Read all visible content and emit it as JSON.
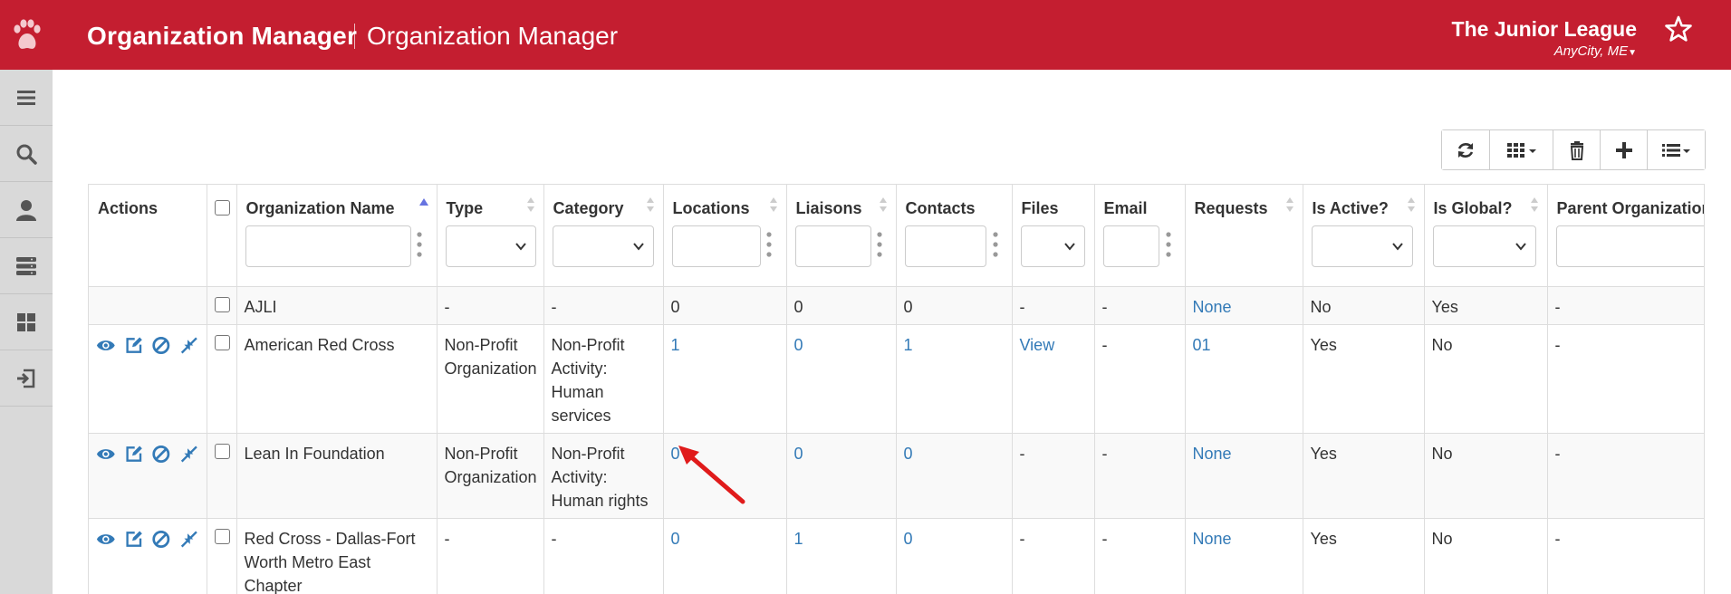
{
  "header": {
    "app_title": "Organization Manager",
    "page_title": "Organization Manager",
    "org_name": "The Junior League",
    "org_city": "AnyCity, ME",
    "brand_color": "#c41e30"
  },
  "sidebar": {
    "items": [
      {
        "icon": "menu-icon"
      },
      {
        "icon": "search-icon"
      },
      {
        "icon": "user-icon"
      },
      {
        "icon": "server-icon"
      },
      {
        "icon": "dashboard-icon"
      },
      {
        "icon": "sign-out-icon"
      }
    ]
  },
  "toolbar": {
    "buttons": [
      "refresh-icon",
      "columns-icon",
      "trash-icon",
      "plus-icon",
      "list-icon"
    ]
  },
  "table": {
    "columns": {
      "actions": "Actions",
      "name": "Organization Name",
      "type": "Type",
      "category": "Category",
      "locations": "Locations",
      "liaisons": "Liaisons",
      "contacts": "Contacts",
      "files": "Files",
      "email": "Email",
      "requests": "Requests",
      "active": "Is Active?",
      "global": "Is Global?",
      "parent": "Parent Organization"
    },
    "rows": [
      {
        "name": "AJLI",
        "type": "-",
        "category": "-",
        "locations": "0",
        "liaisons": "0",
        "contacts": "0",
        "files": "-",
        "email": "-",
        "requests": "None",
        "active": "No",
        "global": "Yes",
        "parent": "-"
      },
      {
        "name": "American Red Cross",
        "type": "Non-Profit Organization",
        "category": "Non-Profit Activity: Human services",
        "locations": "1",
        "liaisons": "0",
        "contacts": "1",
        "files": "View",
        "email": "-",
        "requests": "01",
        "active": "Yes",
        "global": "No",
        "parent": "-"
      },
      {
        "name": "Lean In Foundation",
        "type": "Non-Profit Organization",
        "category": "Non-Profit Activity: Human rights",
        "locations": "0",
        "liaisons": "0",
        "contacts": "0",
        "files": "-",
        "email": "-",
        "requests": "None",
        "active": "Yes",
        "global": "No",
        "parent": "-"
      },
      {
        "name": "Red Cross - Dallas-Fort Worth Metro East Chapter",
        "type": "-",
        "category": "-",
        "locations": "0",
        "liaisons": "1",
        "contacts": "0",
        "files": "-",
        "email": "-",
        "requests": "None",
        "active": "Yes",
        "global": "No",
        "parent": "-"
      }
    ]
  }
}
